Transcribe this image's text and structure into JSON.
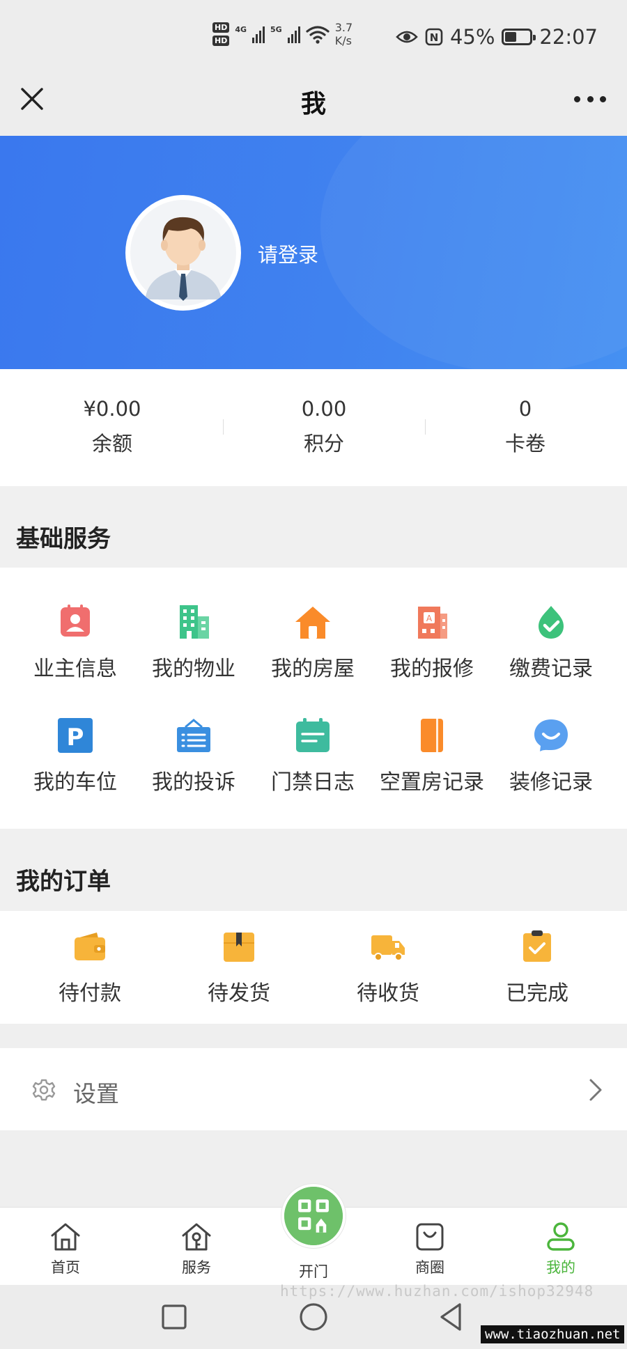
{
  "status_bar": {
    "hd1": "HD",
    "hd2": "HD",
    "net1": "4G",
    "net2": "5G",
    "speed_value": "3.7",
    "speed_unit": "K/s",
    "nfc": "N",
    "battery_percent": "45%",
    "battery_level": 0.45,
    "time": "22:07"
  },
  "title_bar": {
    "title": "我"
  },
  "profile": {
    "login_prompt": "请登录"
  },
  "stats": [
    {
      "value": "¥0.00",
      "label": "余额"
    },
    {
      "value": "0.00",
      "label": "积分"
    },
    {
      "value": "0",
      "label": "卡卷"
    }
  ],
  "services": {
    "title": "基础服务",
    "items": [
      {
        "label": "业主信息",
        "icon": "owner-info-icon",
        "color": "#f06e6e"
      },
      {
        "label": "我的物业",
        "icon": "building-icon",
        "color": "#3ec48a"
      },
      {
        "label": "我的房屋",
        "icon": "house-icon",
        "color": "#fa8b2a"
      },
      {
        "label": "我的报修",
        "icon": "repair-icon",
        "color": "#f0795b"
      },
      {
        "label": "缴费记录",
        "icon": "payment-check-icon",
        "color": "#3dc27b"
      },
      {
        "label": "我的车位",
        "icon": "parking-icon",
        "color": "#2f86d8"
      },
      {
        "label": "我的投诉",
        "icon": "complaint-board-icon",
        "color": "#3a8fe0"
      },
      {
        "label": "门禁日志",
        "icon": "calendar-icon",
        "color": "#3ebb9e"
      },
      {
        "label": "空置房记录",
        "icon": "notebook-icon",
        "color": "#fa8b2a"
      },
      {
        "label": "装修记录",
        "icon": "chat-bubble-icon",
        "color": "#5aa0f0"
      }
    ]
  },
  "orders": {
    "title": "我的订单",
    "items": [
      {
        "label": "待付款",
        "icon": "wallet-icon"
      },
      {
        "label": "待发货",
        "icon": "package-icon"
      },
      {
        "label": "待收货",
        "icon": "truck-icon"
      },
      {
        "label": "已完成",
        "icon": "clipboard-check-icon"
      }
    ],
    "icon_color": "#f7b43a"
  },
  "settings": {
    "label": "设置"
  },
  "tabbar": {
    "items": [
      {
        "label": "首页",
        "icon": "home-icon"
      },
      {
        "label": "服务",
        "icon": "service-house-icon"
      },
      {
        "label": "开门",
        "icon": "qr-door-icon"
      },
      {
        "label": "商圈",
        "icon": "shopping-bag-icon"
      },
      {
        "label": "我的",
        "icon": "person-icon"
      }
    ],
    "active_color": "#4bb53c"
  },
  "watermarks": {
    "url": "https://www.huzhan.com/ishop32948",
    "site": "www.tiaozhuan.net"
  }
}
